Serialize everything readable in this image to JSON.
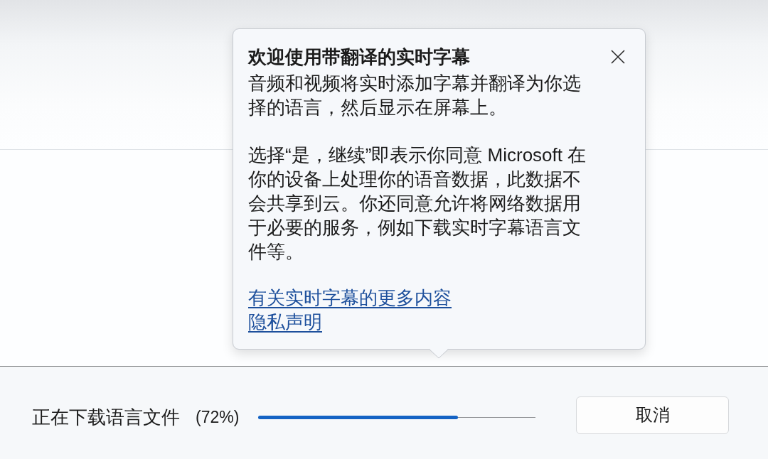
{
  "teaching_tip": {
    "title": "欢迎使用带翻译的实时字幕",
    "paragraphs": [
      "音频和视频将实时添加字幕并翻译为你选择的语言，然后显示在屏幕上。",
      "选择“是，继续”即表示你同意 Microsoft 在你的设备上处理你的语音数据，此数据不会共享到云。你还同意允许将网络数据用于必要的服务，例如下载实时字幕语言文件等。"
    ],
    "links": [
      "有关实时字幕的更多内容",
      "隐私声明"
    ]
  },
  "download": {
    "label": "正在下载语言文件",
    "percent": "(72%)",
    "level": 0.72
  },
  "buttons": [
    "取消"
  ]
}
